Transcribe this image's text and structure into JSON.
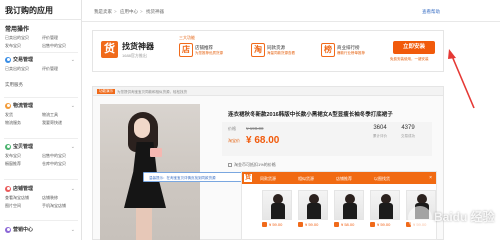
{
  "sidebar": {
    "title": "我订购的应用",
    "common": {
      "heading": "常用操作",
      "links": [
        "已卖出的宝贝",
        "评价管理",
        "发布宝贝",
        "出售中的宝贝"
      ]
    },
    "sections": [
      {
        "name": "交易管理",
        "color": "#3a8ee6",
        "links": [
          "已卖出的宝贝",
          "评价管理"
        ]
      },
      {
        "name": "物流管理",
        "color": "#f29b38",
        "links": [
          "发货",
          "物流工具",
          "物流服务",
          "我要寄快递"
        ]
      },
      {
        "name": "宝贝管理",
        "color": "#4bb36f",
        "links": [
          "发布宝贝",
          "出售中的宝贝",
          "橱窗推荐",
          "仓库中的宝贝"
        ]
      },
      {
        "name": "店铺管理",
        "color": "#ea5a5a",
        "links": [
          "查看淘宝店铺",
          "店铺装修",
          "图片空间",
          "手机淘宝店铺"
        ]
      },
      {
        "name": "营销中心",
        "color": "#8b67d6",
        "links": []
      }
    ],
    "sub_heading": "实用服务"
  },
  "topbar": {
    "crumbs": [
      "我是卖家",
      "应用中心",
      "找货神器"
    ],
    "help": "查看帮助"
  },
  "app": {
    "logo_char": "货",
    "name": "找货神器",
    "sub": "1688官方推出",
    "features_title": "三大功能",
    "features": [
      {
        "icon": "店",
        "title": "店铺推荐",
        "desc": "为您推荐优质货源"
      },
      {
        "icon": "淘",
        "title": "同款货源",
        "desc": "海量同款货源查看"
      },
      {
        "icon": "榜",
        "title": "商业排行榜",
        "desc": "爆款行业榜单推荐"
      }
    ],
    "install_label": "立即安装",
    "install_note": "免费安装使用，一键安装"
  },
  "preview": {
    "tag": "功能演示",
    "note": "为您提供淘宝宝贝同款和相似货源，轻松找货"
  },
  "product": {
    "title": "连衣裙秋冬新款2016韩版中长款小黑裙女A型显瘦长袖冬季打底裙子",
    "orig_label": "价格",
    "orig_price": "¥ 198.00",
    "sale_label": "淘宝价",
    "sale_price": "¥ 68.00",
    "stats": [
      {
        "value": "3604",
        "label": "累计评价"
      },
      {
        "value": "4379",
        "label": "交易成功"
      }
    ],
    "shipping": "淘金币可抵扣1%的价格"
  },
  "tooltip": {
    "text": "温馨提示：在淘宝宝贝详情页找到同款货源",
    "button": "知道了"
  },
  "similar": {
    "logo_char": "货",
    "tabs": [
      "同款货源",
      "相似货源",
      "店铺推荐",
      "以图找货"
    ],
    "close": "×",
    "items": [
      {
        "price": "¥ 59.00"
      },
      {
        "price": "¥ 59.00"
      },
      {
        "price": "¥ 58.00"
      },
      {
        "price": "¥ 59.00"
      },
      {
        "price": "¥ 59.00"
      }
    ]
  },
  "watermark": "Baidu 经验",
  "colors": {
    "accent": "#f15a0b",
    "annotation": "#e53935",
    "link": "#3a6fc4"
  }
}
